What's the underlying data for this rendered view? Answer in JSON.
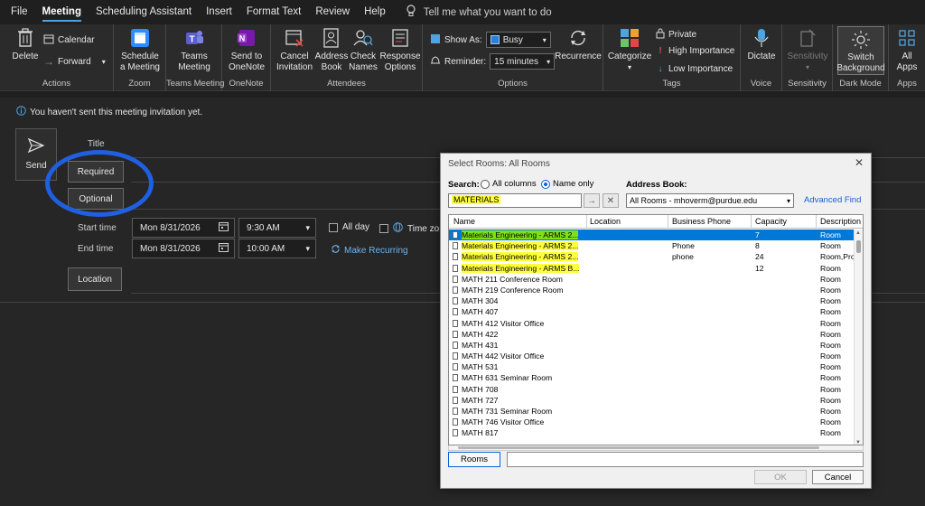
{
  "menu": {
    "tabs": [
      "File",
      "Meeting",
      "Scheduling Assistant",
      "Insert",
      "Format Text",
      "Review",
      "Help"
    ],
    "active": "Meeting",
    "tell_me": "Tell me what you want to do"
  },
  "ribbon": {
    "actions": {
      "delete": "Delete",
      "calendar": "Calendar",
      "forward": "Forward",
      "label": "Actions"
    },
    "zoom": {
      "schedule_line1": "Schedule",
      "schedule_line2": "a Meeting",
      "label": "Zoom"
    },
    "teams": {
      "line1": "Teams",
      "line2": "Meeting",
      "label": "Teams Meeting"
    },
    "onenote": {
      "line1": "Send to",
      "line2": "OneNote",
      "label": "OneNote"
    },
    "attendees": {
      "cancel_line1": "Cancel",
      "cancel_line2": "Invitation",
      "address_line1": "Address",
      "address_line2": "Book",
      "check_line1": "Check",
      "check_line2": "Names",
      "response_line1": "Response",
      "response_line2": "Options",
      "label": "Attendees"
    },
    "options": {
      "show_as_label": "Show As:",
      "show_as_value": "Busy",
      "reminder_label": "Reminder:",
      "reminder_value": "15 minutes",
      "recurrence": "Recurrence",
      "label": "Options"
    },
    "tags": {
      "categorize": "Categorize",
      "private": "Private",
      "high": "High Importance",
      "low": "Low Importance",
      "label": "Tags"
    },
    "voice": {
      "dictate": "Dictate",
      "label": "Voice"
    },
    "sensitivity": {
      "button": "Sensitivity",
      "label": "Sensitivity"
    },
    "darkmode": {
      "line1": "Switch",
      "line2": "Background",
      "label": "Dark Mode"
    },
    "apps": {
      "line1": "All",
      "line2": "Apps",
      "label": "Apps"
    }
  },
  "form": {
    "info": "You haven't sent this meeting invitation yet.",
    "send": "Send",
    "title_label": "Title",
    "required": "Required",
    "optional": "Optional",
    "start_label": "Start time",
    "end_label": "End time",
    "start_date": "Mon 8/31/2026",
    "start_time": "9:30 AM",
    "end_date": "Mon 8/31/2026",
    "end_time": "10:00 AM",
    "all_day": "All day",
    "time_zones": "Time zones",
    "make_recurring": "Make Recurring",
    "location": "Location"
  },
  "dialog": {
    "title": "Select Rooms: All Rooms",
    "search_label": "Search:",
    "all_columns": "All columns",
    "name_only": "Name only",
    "address_book_label": "Address Book:",
    "search_value": "MATERIALS",
    "address_book_value": "All Rooms - mhoverm@purdue.edu",
    "advanced_find": "Advanced Find",
    "columns": [
      "Name",
      "Location",
      "Business Phone",
      "Capacity",
      "Description"
    ],
    "rows": [
      {
        "name": "Materials Engineering - ARMS 2...",
        "location": "",
        "phone": "",
        "capacity": "7",
        "desc": "Room",
        "selected": true,
        "highlight": true
      },
      {
        "name": "Materials Engineering - ARMS 2...",
        "location": "",
        "phone": "Phone",
        "capacity": "8",
        "desc": "Room",
        "highlight": true
      },
      {
        "name": "Materials Engineering - ARMS 2...",
        "location": "",
        "phone": "phone",
        "capacity": "24",
        "desc": "Room,Pro",
        "highlight": true
      },
      {
        "name": "Materials Engineering - ARMS B...",
        "location": "",
        "phone": "",
        "capacity": "12",
        "desc": "Room",
        "highlight": true
      },
      {
        "name": "MATH 211 Conference Room",
        "location": "",
        "phone": "",
        "capacity": "",
        "desc": "Room"
      },
      {
        "name": "MATH 219 Conference Room",
        "location": "",
        "phone": "",
        "capacity": "",
        "desc": "Room"
      },
      {
        "name": "MATH 304",
        "location": "",
        "phone": "",
        "capacity": "",
        "desc": "Room"
      },
      {
        "name": "MATH 407",
        "location": "",
        "phone": "",
        "capacity": "",
        "desc": "Room"
      },
      {
        "name": "MATH 412 Visitor Office",
        "location": "",
        "phone": "",
        "capacity": "",
        "desc": "Room"
      },
      {
        "name": "MATH 422",
        "location": "",
        "phone": "",
        "capacity": "",
        "desc": "Room"
      },
      {
        "name": "MATH 431",
        "location": "",
        "phone": "",
        "capacity": "",
        "desc": "Room"
      },
      {
        "name": "MATH 442 Visitor Office",
        "location": "",
        "phone": "",
        "capacity": "",
        "desc": "Room"
      },
      {
        "name": "MATH 531",
        "location": "",
        "phone": "",
        "capacity": "",
        "desc": "Room"
      },
      {
        "name": "MATH 631 Seminar Room",
        "location": "",
        "phone": "",
        "capacity": "",
        "desc": "Room"
      },
      {
        "name": "MATH 708",
        "location": "",
        "phone": "",
        "capacity": "",
        "desc": "Room"
      },
      {
        "name": "MATH 727",
        "location": "",
        "phone": "",
        "capacity": "",
        "desc": "Room"
      },
      {
        "name": "MATH 731 Seminar Room",
        "location": "",
        "phone": "",
        "capacity": "",
        "desc": "Room"
      },
      {
        "name": "MATH 746 Visitor Office",
        "location": "",
        "phone": "",
        "capacity": "",
        "desc": "Room"
      },
      {
        "name": "MATH 817",
        "location": "",
        "phone": "",
        "capacity": "",
        "desc": "Room"
      }
    ],
    "rooms_button": "Rooms",
    "ok": "OK",
    "cancel": "Cancel"
  },
  "colors": {
    "accent": "#0078d7",
    "highlight": "#ffff3a",
    "annotation": "#1f5fe0"
  }
}
